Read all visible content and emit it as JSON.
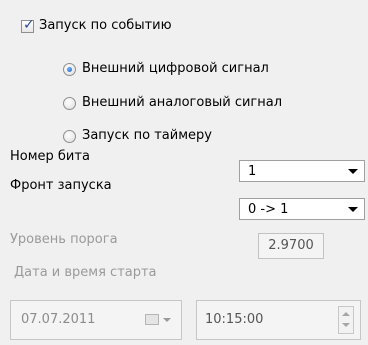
{
  "trigger": {
    "checkbox_label": "Запуск по событию",
    "checkbox_checked": true,
    "radio_options": [
      {
        "label": "Внешний цифровой сигнал",
        "selected": true
      },
      {
        "label": "Внешний аналоговый сигнал",
        "selected": false
      },
      {
        "label": "Запуск по таймеру",
        "selected": false
      }
    ]
  },
  "bit_number": {
    "label": "Номер бита",
    "value": "1"
  },
  "trigger_edge": {
    "label": "Фронт запуска",
    "value": "0 -> 1"
  },
  "threshold": {
    "label": "Уровень порога",
    "value": "2.9700"
  },
  "start": {
    "label": "Дата и время старта",
    "date": "07.07.2011",
    "time": "10:15:00"
  },
  "colors": {
    "accent": "#1c5fbf",
    "disabled_text": "#9a9a9a",
    "background": "#f0f0f0"
  }
}
